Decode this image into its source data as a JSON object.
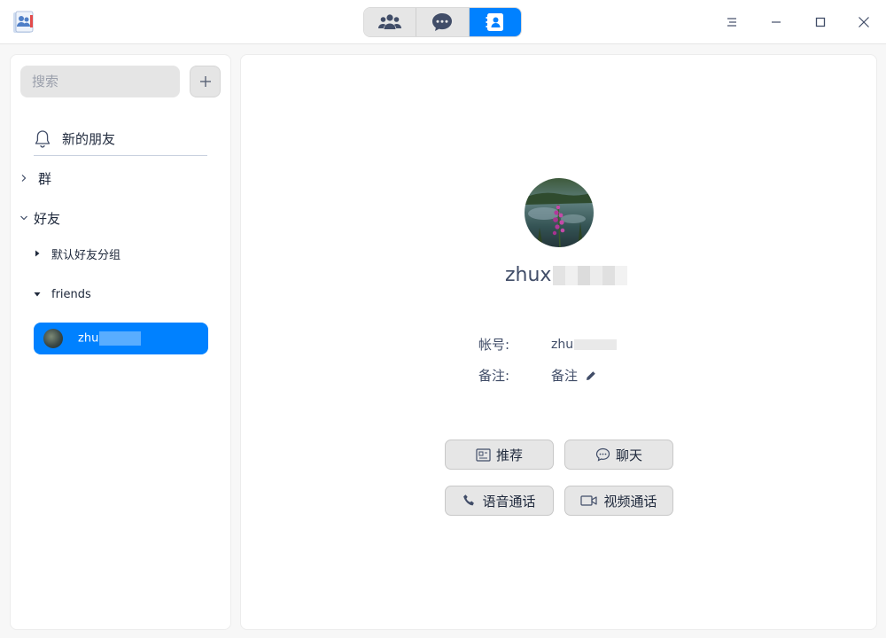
{
  "titlebar": {
    "tabs": [
      {
        "name": "groups-tab",
        "icon": "people-icon",
        "active": false
      },
      {
        "name": "chats-tab",
        "icon": "chat-bubble-icon",
        "active": false
      },
      {
        "name": "contacts-tab",
        "icon": "contact-card-icon",
        "active": true
      }
    ]
  },
  "sidebar": {
    "search_placeholder": "搜索",
    "add_label": "+",
    "new_friends_label": "新的朋友",
    "groups_label": "群",
    "friends_label": "好友",
    "default_group_label": "默认好友分组",
    "friends_group_label": "friends",
    "selected_friend": "zhu"
  },
  "profile": {
    "display_name": "zhux",
    "account_label": "帐号:",
    "account_value": "zhu",
    "remark_label": "备注:",
    "remark_value": "备注"
  },
  "actions": {
    "recommend": "推荐",
    "chat": "聊天",
    "voice_call": "语音通话",
    "video_call": "视频通话"
  },
  "colors": {
    "accent": "#0081ff",
    "text": "#414d68",
    "button_bg": "#e6e6e6"
  }
}
